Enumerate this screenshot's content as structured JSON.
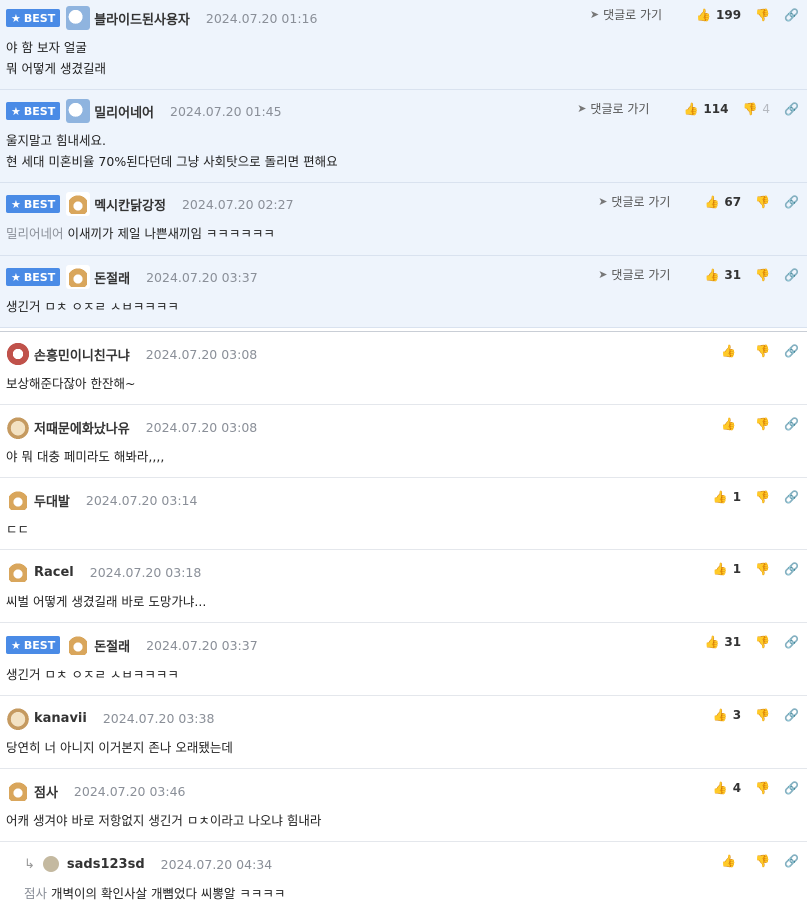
{
  "ui": {
    "best_label": "BEST",
    "goto_label": "댓글로 가기"
  },
  "best_comments": [
    {
      "nick": "블라이드된사용자",
      "date": "2024.07.20 01:16",
      "lines": [
        "야 함 보자 얼굴",
        "뭐 어떻게 생겼길래"
      ],
      "likes": "199",
      "dislikes": ""
    },
    {
      "nick": "밀리어네어",
      "date": "2024.07.20 01:45",
      "lines": [
        "울지말고 힘내세요.",
        "현 세대 미혼비율 70%된다던데 그냥 사회탓으로 돌리면 편해요"
      ],
      "likes": "114",
      "dislikes": "4"
    },
    {
      "nick": "멕시칸닭강정",
      "date": "2024.07.20 02:27",
      "mention": "밀리어네어",
      "lines": [
        "이새끼가 제일 나쁜새끼임 ㅋㅋㅋㅋㅋㅋ"
      ],
      "likes": "67",
      "dislikes": ""
    },
    {
      "nick": "돈절래",
      "date": "2024.07.20 03:37",
      "lines": [
        "생긴거 ㅁㅊ ㅇㅈㄹ ㅅㅂㅋㅋㅋㅋ"
      ],
      "likes": "31",
      "dislikes": ""
    }
  ],
  "comments": [
    {
      "nick": "손흥민이니친구냐",
      "date": "2024.07.20 03:08",
      "text": "보상해준다잖아 한잔해~",
      "likes": ""
    },
    {
      "nick": "저때문에화났나유",
      "date": "2024.07.20 03:08",
      "text": "야 뭐 대충 페미라도 해봐라,,,,",
      "likes": ""
    },
    {
      "nick": "두대발",
      "date": "2024.07.20 03:14",
      "text": "ㄷㄷ",
      "likes": "1"
    },
    {
      "nick": "Racel",
      "date": "2024.07.20 03:18",
      "text": "씨벌 어떻게 생겼길래 바로 도망가냐...",
      "likes": "1"
    },
    {
      "nick": "돈절래",
      "date": "2024.07.20 03:37",
      "text": "생긴거 ㅁㅊ ㅇㅈㄹ ㅅㅂㅋㅋㅋㅋ",
      "likes": "31",
      "best": "BEST"
    },
    {
      "nick": "kanavii",
      "date": "2024.07.20 03:38",
      "text": "당연히 너 아니지 이거본지 존나 오래됐는데",
      "likes": "3"
    },
    {
      "nick": "점사",
      "date": "2024.07.20 03:46",
      "text": "어캐 생겨야 바로 저항없지 생긴거 ㅁㅊ이라고 나오냐 힘내라",
      "likes": "4"
    }
  ],
  "reply": {
    "nick": "sads123sd",
    "date": "2024.07.20 04:34",
    "mention": "점사",
    "text": "개벽이의 확인사살 개뼘었다 씨뽕알 ㅋㅋㅋㅋ",
    "likes": ""
  },
  "icons": {
    "best": "star-icon",
    "goto": "send-arrow-icon",
    "like": "thumbs-up-icon",
    "dislike": "thumbs-down-icon",
    "link": "link-icon",
    "reply": "reply-arrow-icon"
  },
  "colors": {
    "badge": "#4a8be6",
    "best_bg": "#eef4fc",
    "meta": "#8a8f98"
  }
}
